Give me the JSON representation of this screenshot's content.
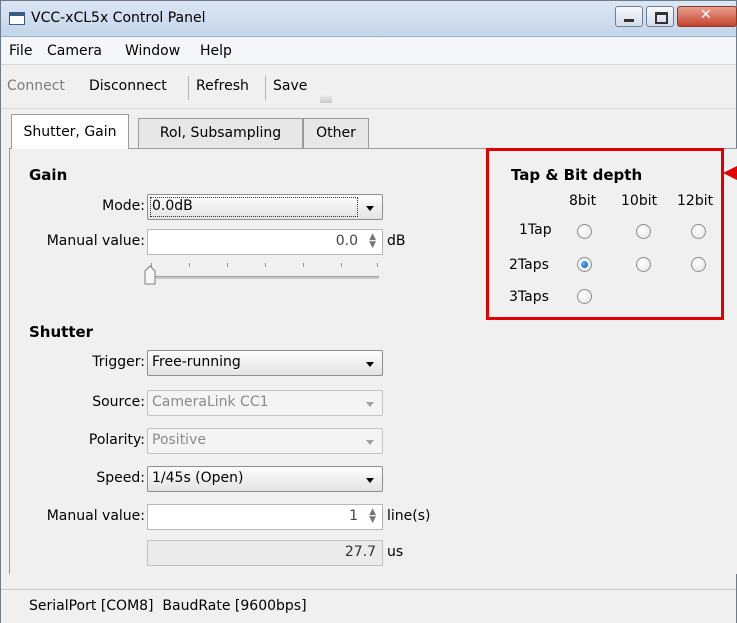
{
  "window": {
    "title": "VCC-xCL5x Control Panel"
  },
  "menu": {
    "file": "File",
    "camera": "Camera",
    "window": "Window",
    "help": "Help"
  },
  "toolbar": {
    "connect": "Connect",
    "disconnect": "Disconnect",
    "refresh": "Refresh",
    "save": "Save"
  },
  "tabs": [
    {
      "label": "Shutter, Gain"
    },
    {
      "label": "RoI, Subsampling"
    },
    {
      "label": "Other"
    }
  ],
  "gain": {
    "title": "Gain",
    "mode_label": "Mode:",
    "mode_value": "0.0dB",
    "manual_label": "Manual value:",
    "manual_value": "0.0",
    "manual_unit": "dB",
    "slider_value": 0
  },
  "shutter": {
    "title": "Shutter",
    "trigger_label": "Trigger:",
    "trigger_value": "Free-running",
    "source_label": "Source:",
    "source_value": "CameraLink CC1",
    "polarity_label": "Polarity:",
    "polarity_value": "Positive",
    "speed_label": "Speed:",
    "speed_value": "1/45s (Open)",
    "manual_label": "Manual value:",
    "manual_value": "1",
    "manual_unit": "line(s)",
    "time_value": "27.7",
    "time_unit": "us"
  },
  "tap": {
    "title": "Tap & Bit depth",
    "columns": [
      "8bit",
      "10bit",
      "12bit"
    ],
    "rows": [
      "1Tap",
      "2Taps",
      "3Taps"
    ],
    "selected": "2Taps-8bit"
  },
  "status": {
    "text": "SerialPort [COM8]  BaudRate [9600bps]"
  },
  "colors": {
    "highlight": "#e00000",
    "radio_selected": "#0d5aa7"
  }
}
